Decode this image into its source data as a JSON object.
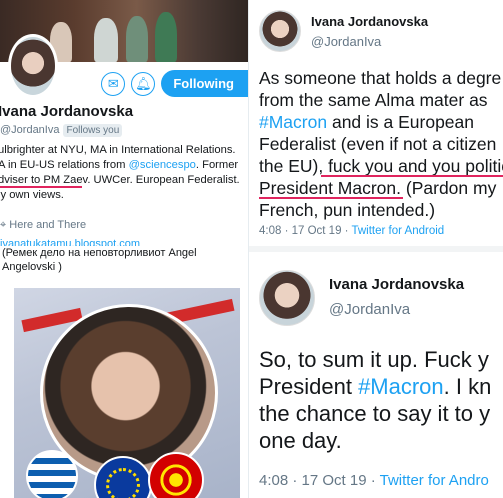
{
  "profile": {
    "name": "Ivana Jordanovska",
    "handle": "@JordanIva",
    "follows_you": "Follows you",
    "follow_button": "Following",
    "mail_icon": "mail-icon",
    "bell_icon": "bell-plus-icon",
    "bio_line1": "ulbrighter at NYU, MA in International Relations.",
    "bio_line2_a": "A in EU-US relations from ",
    "bio_line2_link": "@sciencespo",
    "bio_line2_b": ". Former",
    "bio_line3": "dviser to PM Zaev. UWCer. European Federalist.",
    "bio_line4": "ly own views.",
    "location": "Here and There",
    "url": "ivanatukatamu.blogspot.com"
  },
  "photo_post": {
    "caption_line1": "(Ремек дело на неповторливиот Angel",
    "caption_line2": "Angelovski )"
  },
  "tweet1": {
    "name": "Ivana Jordanovska",
    "handle": "@JordanIva",
    "line1": "As someone that holds a degre",
    "line2": "from the same Alma mater as",
    "line3_hash": "#Macron",
    "line3_rest": " and is a European",
    "line4": "Federalist (even if not a citizen",
    "line5_a": "the EU), ",
    "line5_b": "fuck you and you politic",
    "line6_a": "President Macron.",
    "line6_b": " (Pardon my",
    "line7": "French, pun intended.)",
    "time": "4:08 · 17 Oct 19 · ",
    "source": "Twitter for Android"
  },
  "tweet2": {
    "name": "Ivana Jordanovska",
    "handle": "@JordanIva",
    "line1": "So, to sum it up. Fuck y",
    "line2_a": "President ",
    "line2_hash": "#Macron",
    "line2_b": ". I kn",
    "line3": "the chance to say it to y",
    "line4": "one day.",
    "time": "4:08 · 17 Oct 19 · ",
    "source": "Twitter for Andro"
  },
  "colors": {
    "accent": "#1da1f2",
    "underline": "#e0245e",
    "muted": "#657786"
  }
}
